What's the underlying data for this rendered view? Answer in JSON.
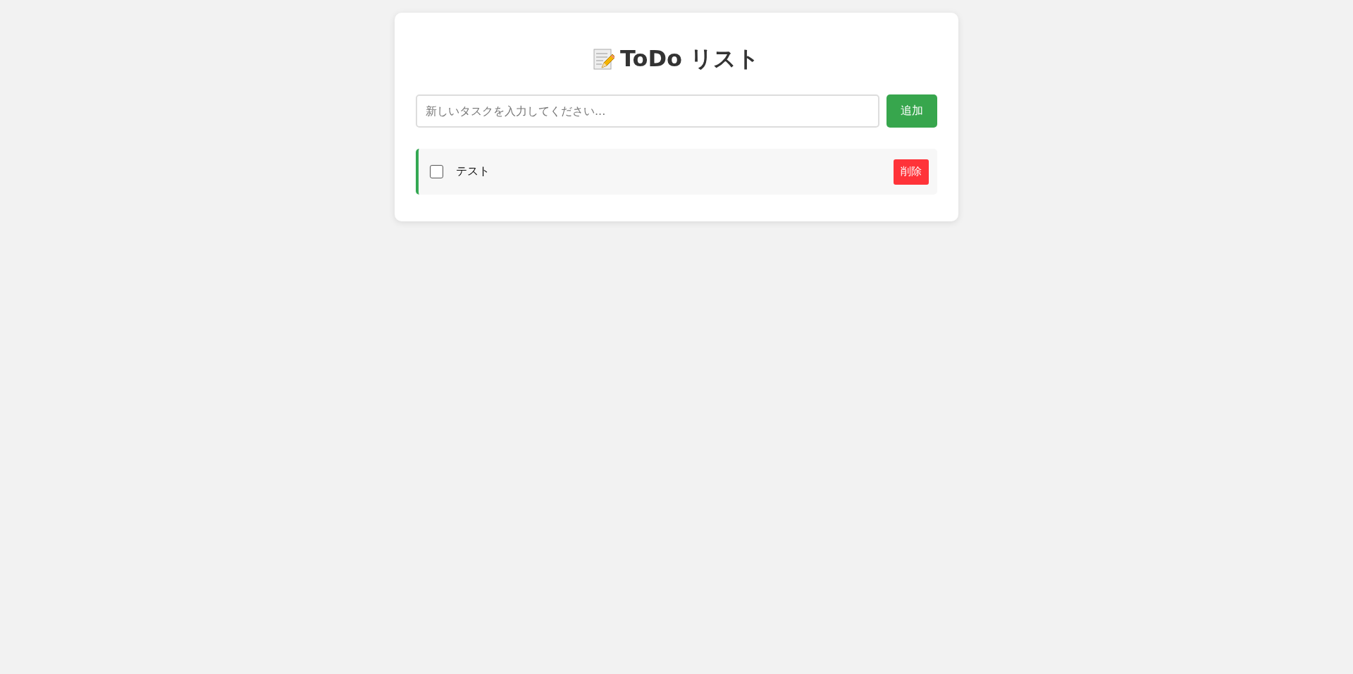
{
  "title": "ToDo リスト",
  "new_task": {
    "placeholder": "新しいタスクを入力してください...",
    "button": "追加"
  },
  "todos": [
    {
      "text": "テスト",
      "checked": false,
      "delete_button": "削除"
    }
  ]
}
